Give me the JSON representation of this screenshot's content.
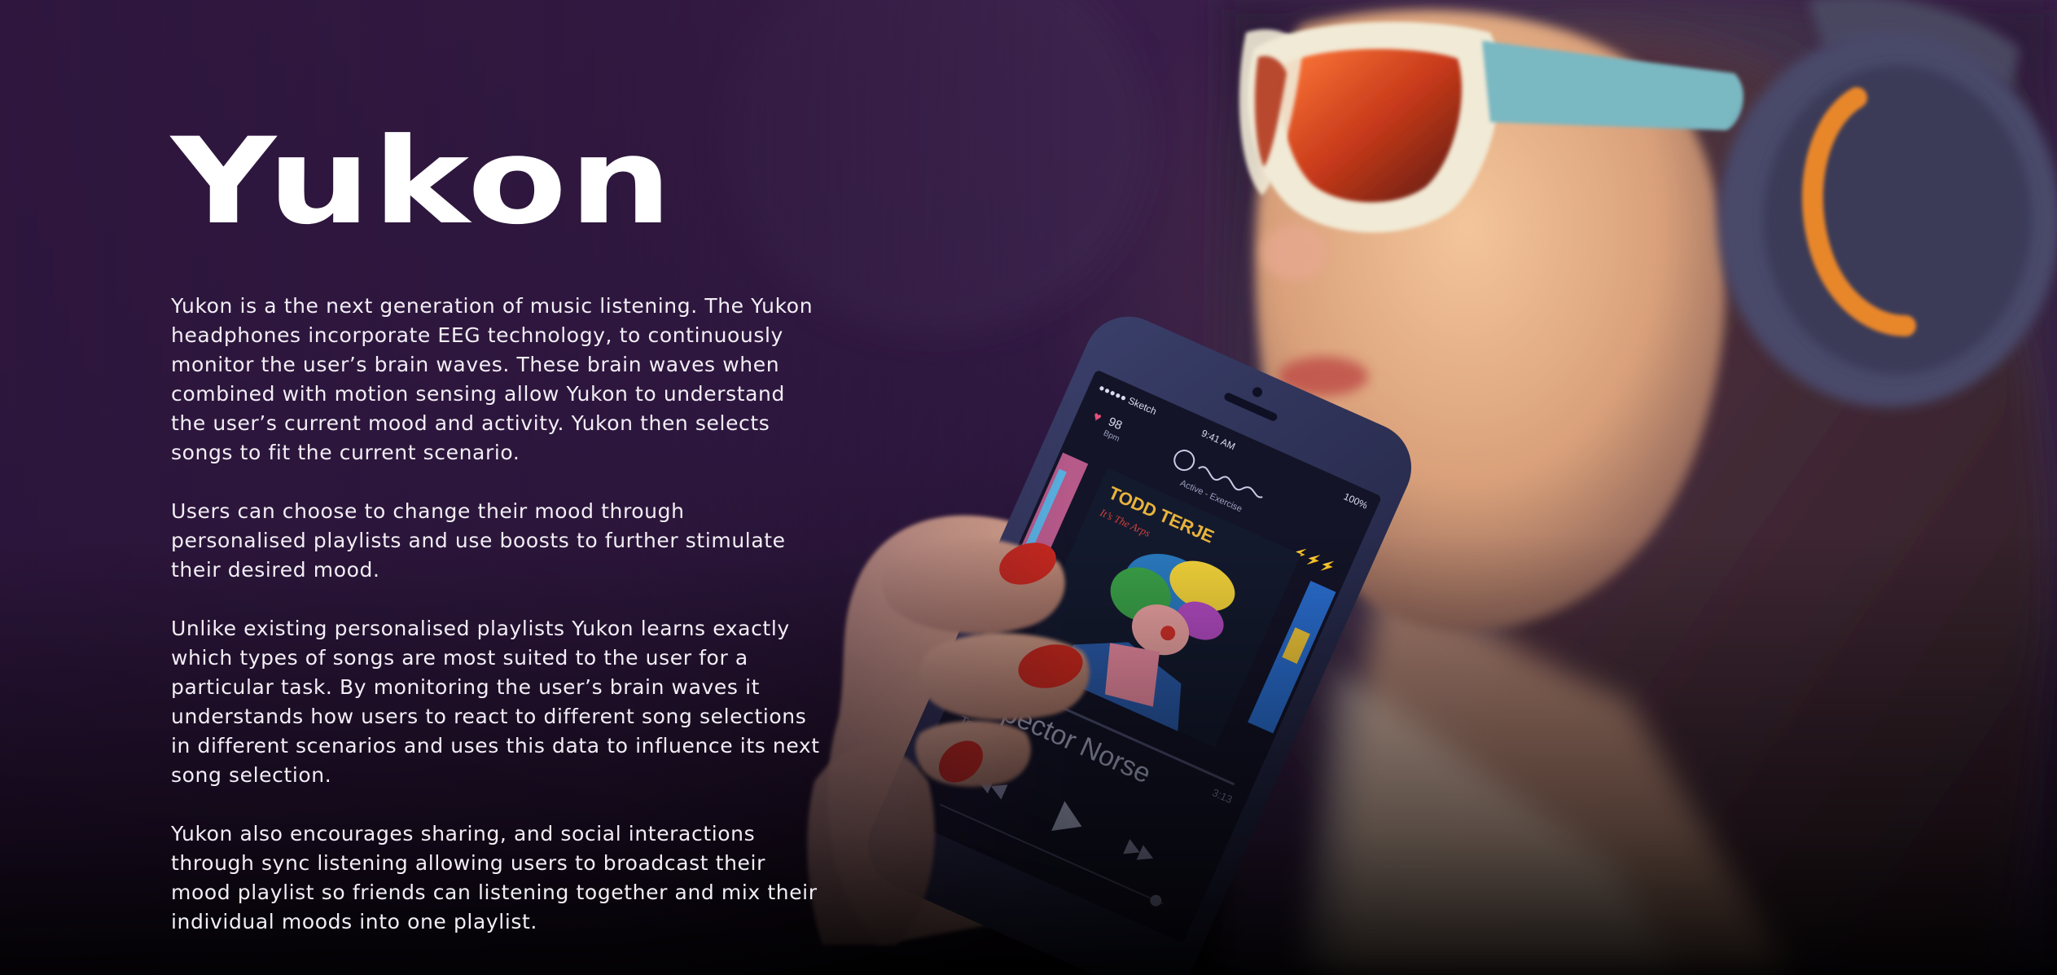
{
  "brand": {
    "name": "Yukon"
  },
  "paragraphs": [
    "Yukon is a the next generation of music listening. The Yukon\nheadphones incorporate EEG technology, to continuously\nmonitor the user’s brain waves. These brain waves when\ncombined with motion sensing allow Yukon to understand\nthe user’s current mood and activity. Yukon then selects\nsongs to fit the current scenario.",
    "Users can choose to change their mood through\npersonalised playlists and use boosts to further stimulate\ntheir desired mood.",
    "Unlike existing personalised playlists Yukon learns exactly\nwhich types of songs are most suited to the user for a\nparticular task. By monitoring the user’s brain waves it\nunderstands how users to react to different song selections\nin different scenarios and uses this data to influence its next\nsong selection.",
    "Yukon also encourages sharing, and social interactions\nthrough sync listening allowing users to broadcast their\nmood playlist so friends can listening together and mix their\nindividual moods into one playlist."
  ],
  "phone_screen": {
    "carrier": "●●●●● Sketch",
    "time": "9:41 AM",
    "battery": "100%",
    "heart_rate": "98",
    "heart_rate_unit": "Bpm",
    "activity": "Active - Exercise",
    "album_artist_art": "TODD TERJE",
    "song_title": "Inspector Norse",
    "song_artist": "Todd Terje",
    "song_duration": "3:13"
  },
  "colors": {
    "background": "#2a1636",
    "text": "#ffffff",
    "accent_orange": "#e8862a",
    "nail_red": "#c8281e"
  }
}
